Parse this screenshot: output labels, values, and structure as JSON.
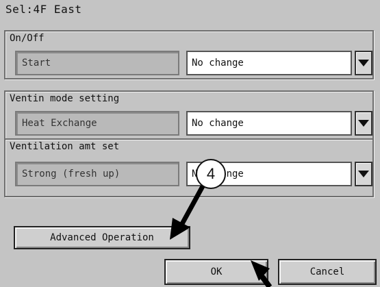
{
  "window": {
    "title": "Sel:4F East"
  },
  "groups": [
    {
      "label": "On/Off",
      "current": "Start",
      "selection": "No change"
    },
    {
      "label": "Ventin mode setting",
      "current": "Heat Exchange",
      "selection": "No change"
    },
    {
      "label": "Ventilation amt set",
      "current": "Strong (fresh up)",
      "selection": "No change"
    }
  ],
  "buttons": {
    "advanced": "Advanced Operation",
    "ok": "OK",
    "cancel": "Cancel"
  },
  "callout": {
    "number": "4"
  },
  "icons": {
    "dropdown": "triangle-down-icon",
    "pointer": "arrow-icon"
  }
}
